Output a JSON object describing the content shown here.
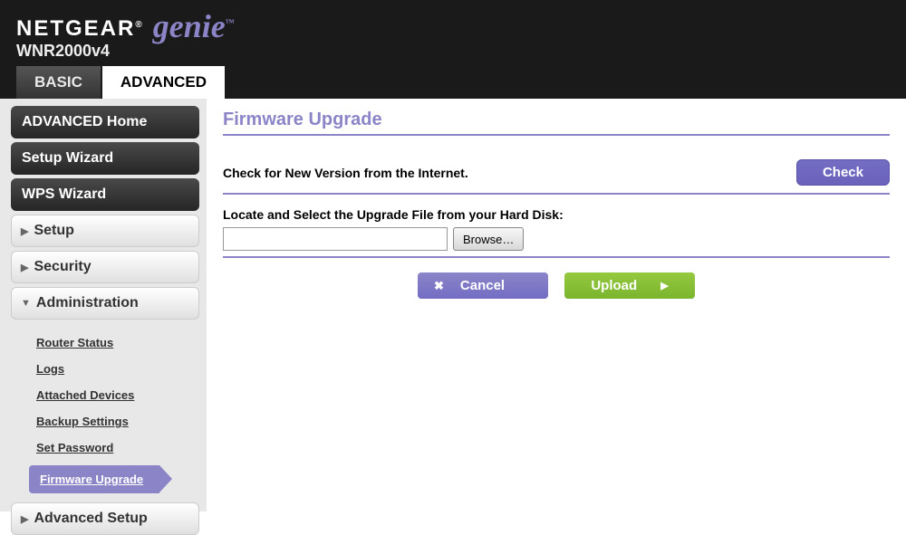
{
  "header": {
    "brand": "NETGEAR",
    "product": "genie",
    "model": "WNR2000v4"
  },
  "tabs": {
    "basic": "BASIC",
    "advanced": "ADVANCED"
  },
  "sidebar": {
    "buttons": {
      "home": "ADVANCED Home",
      "setup_wizard": "Setup Wizard",
      "wps_wizard": "WPS Wizard"
    },
    "sections": {
      "setup": "Setup",
      "security": "Security",
      "administration": "Administration",
      "advanced_setup": "Advanced Setup"
    },
    "admin_items": {
      "router_status": "Router Status",
      "logs": "Logs",
      "attached_devices": "Attached Devices",
      "backup_settings": "Backup Settings",
      "set_password": "Set Password",
      "firmware_upgrade": "Firmware Upgrade"
    }
  },
  "content": {
    "title": "Firmware Upgrade",
    "check_label": "Check for New Version from the Internet.",
    "check_button": "Check",
    "locate_label": "Locate and Select the Upgrade File from your Hard Disk:",
    "file_value": "",
    "browse_button": "Browse…",
    "cancel_button": "Cancel",
    "upload_button": "Upload"
  }
}
